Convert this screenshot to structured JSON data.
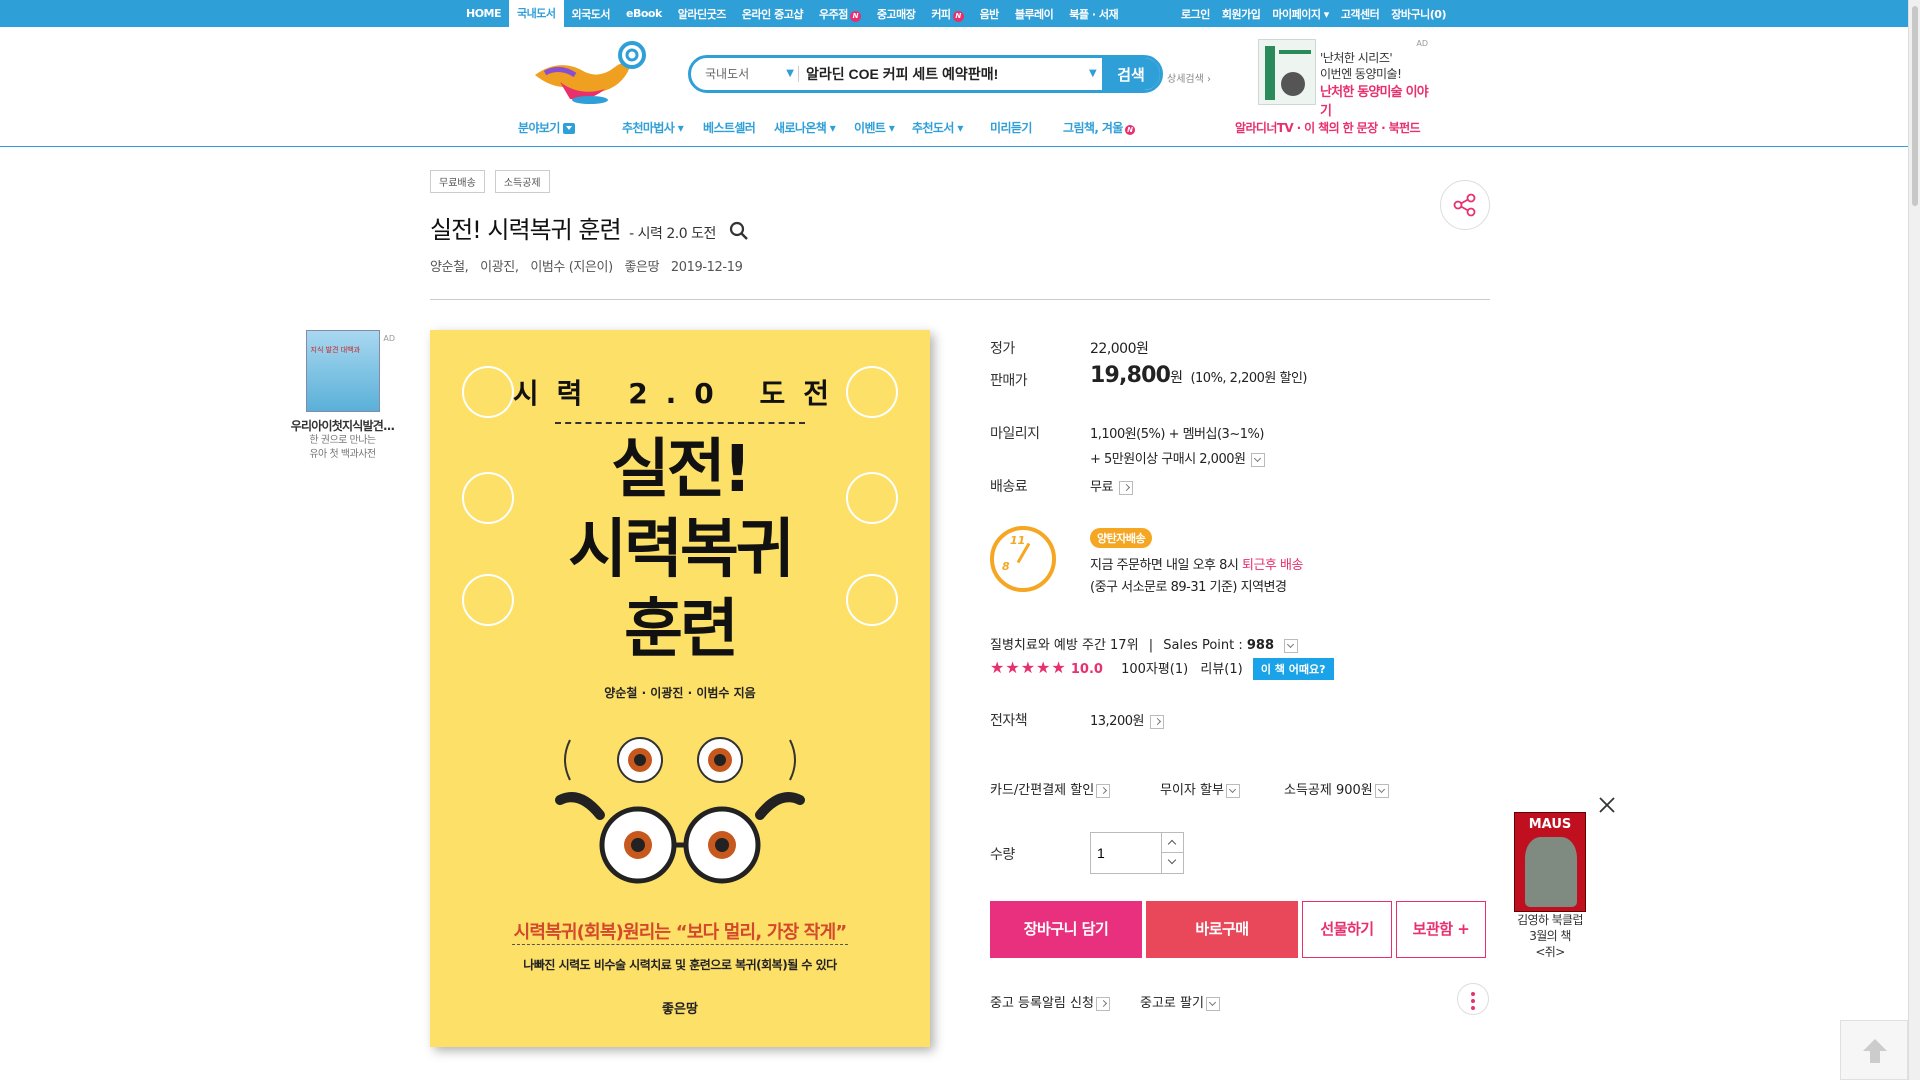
{
  "topnav": {
    "links": [
      {
        "label": "HOME"
      },
      {
        "label": "국내도서",
        "active": true
      },
      {
        "label": "외국도서"
      },
      {
        "label": "eBook"
      },
      {
        "label": "알라딘굿즈"
      },
      {
        "label": "온라인 중고샵"
      },
      {
        "label": "우주점",
        "badge": "N"
      },
      {
        "label": "중고매장"
      },
      {
        "label": "커피",
        "badge": "N"
      },
      {
        "label": "음반"
      },
      {
        "label": "블루레이"
      },
      {
        "label": "북플 · 서재"
      }
    ],
    "right": [
      "로그인",
      "회원가입",
      "마이페이지 ▾",
      "고객센터",
      "장바구니(0)"
    ]
  },
  "search": {
    "category": "국내도서",
    "value": "알라딘 COE 커피 세트 예약판매!",
    "button": "검색",
    "advanced": "상세검색 ›"
  },
  "header_ad": {
    "line1": "'난처한 시리즈'",
    "line2": "이번엔 동양미술!",
    "line3": "난처한 동양미술 이야기",
    "tag": "AD"
  },
  "subnav": {
    "browse": "분야보기",
    "items": [
      "추천마법사 ▾",
      "베스트셀러",
      "새로나온책 ▾",
      "이벤트 ▾",
      "추천도서 ▾",
      "미리듣기",
      "그림책, 겨울"
    ],
    "right": "알라디너TV · 이 책의 한 문장 · 북펀드"
  },
  "product": {
    "tags": [
      "무료배송",
      "소득공제"
    ],
    "title": "실전! 시력복귀 훈련",
    "subtitle": "- 시력 2.0 도전",
    "authors": [
      "양순철,",
      "이광진,",
      "이범수 (지은이)",
      "좋은땅",
      "2019-12-19"
    ]
  },
  "left_ad": {
    "name": "우리아이첫지식발견...",
    "desc1": "한 권으로 만나는",
    "desc2": "유아 첫 백과사전",
    "tag": "AD",
    "cover_text": "지식 발견 대백과"
  },
  "cover": {
    "small": "시력 2.0 도전",
    "title_lines": [
      "실전!",
      "시력복귀",
      "훈련"
    ],
    "authors": "양순철 · 이광진 · 이범수 지음",
    "slogan": "시력복귀(회복)원리는 “보다 멀리, 가장 작게”",
    "desc": "나빠진 시력도 비수술 시력치료 및 훈련으로 복귀(회복)될 수 있다",
    "publisher": "좋은땅"
  },
  "price": {
    "list_label": "정가",
    "list_price": "22,000원",
    "sale_label": "판매가",
    "sale_price": "19,800",
    "sale_unit": "원",
    "discount": "(10%, 2,200원 할인)",
    "mileage_label": "마일리지",
    "mileage1": "1,100원(5%) + 멤버십(3~1%)",
    "mileage2": "+ 5만원이상 구매시 2,000원",
    "ship_label": "배송료",
    "ship_value": "무료"
  },
  "delivery": {
    "badge": "양탄자배송",
    "line1_pre": "지금 주문하면 내일 오후 8시",
    "line1_link": "퇴근후 배송",
    "line2": "(중구 서소문로 89-31 기준) 지역변경",
    "clock_top": "11",
    "clock_bottom": "8"
  },
  "rank": {
    "text": "질병치료와 예방 주간 17위",
    "sales_label": "Sales Point :",
    "sales_value": "988",
    "stars": "★★★★★",
    "score": "10.0",
    "reviews1": "100자평(1)",
    "reviews2": "리뷰(1)",
    "ask": "이 책 어때요?"
  },
  "ebook": {
    "label": "전자책",
    "price": "13,200원"
  },
  "discounts": {
    "card": "카드/간편결제 할인",
    "installment": "무이자 할부",
    "tax": "소득공제 900원"
  },
  "quantity": {
    "label": "수량",
    "value": "1"
  },
  "buttons": {
    "cart": "장바구니 담기",
    "buy": "바로구매",
    "gift": "선물하기",
    "keep": "보관함 +"
  },
  "used": {
    "alert": "중고 등록알림 신청",
    "sell": "중고로 팔기"
  },
  "float_ad": {
    "cover": "MAUS",
    "line1": "김영하 북클럽",
    "line2": "3월의 책",
    "line3": "<쥐>"
  },
  "colors": {
    "brand": "#2f9fd8",
    "accent": "#e8306e",
    "cover": "#fde068",
    "badge": "#f5a623"
  }
}
